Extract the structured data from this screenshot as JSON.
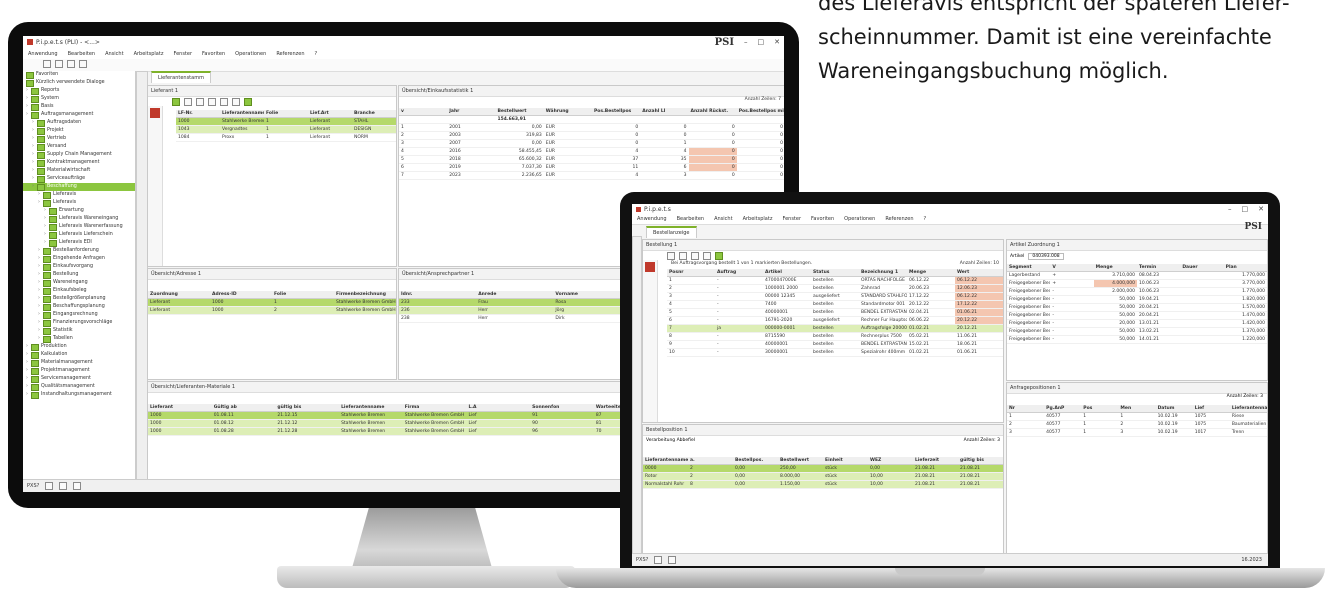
{
  "caption": {
    "line1": "des Lieferavis entspricht der späteren Liefer-",
    "line2": "scheinnummer. Damit ist eine vereinfachte",
    "line3": "Wareneingangsbuchung möglich."
  },
  "desktop": {
    "window_title": "P.i.p.e.t.s (PLI) - <...>",
    "brand": "PSI",
    "menu": [
      "Anwendung",
      "Bearbeiten",
      "Ansicht",
      "Arbeitsplatz",
      "Fenster",
      "Favoriten",
      "Operationen",
      "Referenzen",
      "?"
    ],
    "main_tab": "Lieferantenstamm",
    "nav_items": [
      "Favoriten",
      "Kürzlich verwendete Dialoge",
      "Reports",
      "System",
      "Basis",
      "Auftragsmanagement",
      "Auftragsdaten",
      "Projekt",
      "Vertrieb",
      "Versand",
      "Supply Chain Management",
      "Kontraktmanagement",
      "Materialwirtschaft",
      "Serviceaufträge",
      "Beschaffung",
      "Lieferavis",
      "Lieferavis",
      "Erwartung",
      "Lieferavis Wareneingang",
      "Lieferavis Warenerfassung",
      "Lieferavis Lieferschein",
      "Lieferavis EDI",
      "Bestellanforderung",
      "Eingehende Anfragen",
      "Einkaufsvorgang",
      "Bestellung",
      "Wareneingang",
      "Einkaufsbeleg",
      "Bestellgrößenplanung",
      "Beschaffungsplanung",
      "Eingangsrechnung",
      "Finanzierungsvorschläge",
      "Statistik",
      "Tabellen",
      "Produktion",
      "Kalkulation",
      "Materialmanagement",
      "Projektmanagement",
      "Servicemanagement",
      "Qualitätsmanagement",
      "Instandhaltungsmanagement"
    ],
    "nav_selected": "Beschaffung",
    "status_user": "PXS?",
    "panel_lieferant": {
      "title": "Lieferant 1",
      "columns": [
        "LF-Nr.",
        "Lieferantenname",
        "Folie",
        "Lief.Art",
        "Branche"
      ],
      "rows": [
        [
          "1000",
          "Stahlwerke Bremen",
          "1",
          "Lieferant",
          "STAHL"
        ],
        [
          "1043",
          "Vergnadtes",
          "1",
          "Lieferant",
          "DESIGN"
        ],
        [
          "1084",
          "Proxx",
          "1",
          "Lieferant",
          "NORM"
        ]
      ]
    },
    "panel_umsatz": {
      "title": "Übersicht/Einkaufsstatistik 1",
      "header_note": "Anzahl Zeilen: 7",
      "columns": [
        "v",
        "Jahr",
        "Bestellwert",
        "Währung",
        "Pos.Bestellpos",
        "Anzahl LI",
        "Anzahl Rückst.",
        "Pos.Bestellpos mit Q.M."
      ],
      "total": "154.663,91",
      "rows": [
        [
          "1",
          "2001",
          "0,00",
          "EUR",
          "0",
          "0",
          "0",
          "0"
        ],
        [
          "2",
          "2003",
          "319,83",
          "EUR",
          "0",
          "0",
          "0",
          "0"
        ],
        [
          "3",
          "2007",
          "0,00",
          "EUR",
          "0",
          "1",
          "0",
          "0"
        ],
        [
          "4",
          "2016",
          "58.455,45",
          "EUR",
          "4",
          "4",
          "0",
          "0"
        ],
        [
          "5",
          "2018",
          "65.600,32",
          "EUR",
          "37",
          "35",
          "0",
          "0"
        ],
        [
          "6",
          "2019",
          "7.037,30",
          "EUR",
          "11",
          "6",
          "0",
          "0"
        ],
        [
          "7",
          "2023",
          "2.236,65",
          "EUR",
          "4",
          "3",
          "0",
          "0"
        ]
      ]
    },
    "panel_adressen": {
      "title": "Übersicht/Adresse 1",
      "columns": [
        "Zuordnung",
        "Adress-ID",
        "Folie",
        "Firmenbezeichnung"
      ],
      "rows": [
        [
          "Lieferant",
          "1000",
          "1",
          "Stahlwerke Bremen GmbH"
        ],
        [
          "Lieferant",
          "1000",
          "2",
          "Stahlwerke Bremen GmbH"
        ]
      ]
    },
    "panel_ansprech": {
      "title": "Übersicht/Ansprechpartner 1",
      "columns": [
        "Idnr.",
        "Anrede",
        "Vorname",
        "Nachname",
        "Tel"
      ],
      "rows": [
        [
          "233",
          "Frau",
          "Rosa",
          "Pfaiser",
          "+49 791 7594"
        ],
        [
          "236",
          "Herr",
          "Jörg",
          "Roth",
          "+49 30283"
        ],
        [
          "238",
          "Herr",
          "Dirk",
          "Schultz",
          "+49 30283"
        ]
      ]
    },
    "panel_material": {
      "title": "Übersicht/Lieferanten-Materiale 1",
      "columns": [
        "Lieferant",
        "Gültig ab",
        "gültig bis",
        "Lieferantenname",
        "Firma",
        "L.A",
        "Sonnenfon",
        "Warteeiten",
        "Kursmaßnahmen",
        "Sonstiges"
      ],
      "rows": [
        [
          "1000",
          "01.08.11",
          "21.12.15",
          "Stahlwerke Bremen",
          "Stahlwerke Bremen GmbH",
          "Lief",
          "91",
          "87",
          "150",
          ""
        ],
        [
          "1000",
          "01.08.12",
          "21.12.12",
          "Stahlwerke Bremen",
          "Stahlwerke Bremen GmbH",
          "Lief",
          "90",
          "81",
          "75",
          ""
        ],
        [
          "1000",
          "01.08.28",
          "21.12.28",
          "Stahlwerke Bremen",
          "Stahlwerke Bremen GmbH",
          "Lief",
          "96",
          "70",
          "86",
          ""
        ]
      ]
    }
  },
  "laptop": {
    "window_title": "P.i.p.e.t.s",
    "brand": "PSI",
    "menu": [
      "Anwendung",
      "Bearbeiten",
      "Ansicht",
      "Arbeitsplatz",
      "Fenster",
      "Favoriten",
      "Operationen",
      "Referenzen",
      "?"
    ],
    "main_tab": "Bestellanzeige",
    "panel_bestellung": {
      "title": "Bestellung 1",
      "banner": "Bei Auftragsvorgang bestellt 1 von 1 markierten Bestellungen.",
      "note": "Anzahl Zeilen: 10",
      "columns": [
        "Posnr",
        "Auftrag",
        "Artikel",
        "Status",
        "Bezeichnung 1",
        "Menge",
        "Wert"
      ],
      "rows": [
        [
          "1",
          "-",
          "4700047000E",
          "bestellen",
          "ORTAS NACHFOLGE",
          "06.12.22",
          "06.12.22"
        ],
        [
          "2",
          "-",
          "1000001 2000",
          "bestellen",
          "Zahnrad",
          "20.06.23",
          "12.06.23"
        ],
        [
          "3",
          "-",
          "00000 12345",
          "ausgeliefert",
          "STANDARD STAHLFORM",
          "17.12.22",
          "06.12.22"
        ],
        [
          "4",
          "-",
          "7400",
          "bestellen",
          "Standardmotor 001",
          "20.12.22",
          "17.12.22"
        ],
        [
          "5",
          "-",
          "40000001",
          "bestellen",
          "BENDEL EXTRASTANDARD 9",
          "02.04.21",
          "01.06.21"
        ],
        [
          "6",
          "-",
          "16791-2020",
          "ausgeliefert",
          "Rechner Fur Hauptschaft",
          "06.06.22",
          "20.12.22"
        ],
        [
          "7",
          "ja",
          "000000-0001",
          "bestellen",
          "Auftragsfolge 20000",
          "01.02.21",
          "20.12.21"
        ],
        [
          "8",
          "-",
          "8715590",
          "bestellen",
          "Rechnerplus 7500",
          "05.02.21",
          "11.06.21"
        ],
        [
          "9",
          "-",
          "40000001",
          "bestellen",
          "BENDEL EXTRASTANDARD 10",
          "15.02.21",
          "18.06.21"
        ],
        [
          "10",
          "-",
          "30000001",
          "bestellen",
          "Spezialrohr 400mm",
          "01.02.21",
          "01.06.21"
        ]
      ]
    },
    "panel_artikel": {
      "title": "Artikel Zuordnung 1",
      "artikel_label": "Artikel",
      "artikel_value": "040393.008",
      "columns": [
        "Segment",
        "V",
        "Menge",
        "Termin",
        "Dauer",
        "Plan"
      ],
      "rows": [
        [
          "Lagerbestand",
          "+",
          "3.710,000",
          "08.04.23",
          "",
          "1.770,000"
        ],
        [
          "Freigegebener Bedarf",
          "+",
          "4.000,000",
          "10.06.23",
          "",
          "3.770,000"
        ],
        [
          "Freigegebener Bedarf",
          "-",
          "2.000,000",
          "10.06.23",
          "",
          "1.770,000"
        ],
        [
          "Freigegebener Bedarf",
          "-",
          "50,000",
          "19.04.21",
          "",
          "1.820,000"
        ],
        [
          "Freigegebener Bedarf",
          "-",
          "50,000",
          "20.04.21",
          "",
          "1.570,000"
        ],
        [
          "Freigegebener Bedarf",
          "-",
          "50,000",
          "20.04.21",
          "",
          "1.470,000"
        ],
        [
          "Freigegebener Bedarf",
          "-",
          "20,000",
          "13.01.21",
          "",
          "1.420,000"
        ],
        [
          "Freigegebener Bedarf",
          "-",
          "50,000",
          "13.02.21",
          "",
          "1.370,000"
        ],
        [
          "Freigegebener Bedarf",
          "-",
          "50,000",
          "14.01.21",
          "",
          "1.220,000"
        ]
      ]
    },
    "panel_anfrage": {
      "title": "Anfragepositionen 1",
      "note": "Anzahl Zeilen: 3",
      "columns": [
        "Nr",
        "Pg.AnP",
        "Pos",
        "Men",
        "Datum",
        "Lief",
        "Lieferantenname"
      ],
      "rows": [
        [
          "1",
          "40577",
          "1",
          "1",
          "10.02.19",
          "1075",
          "Riese"
        ],
        [
          "2",
          "40577",
          "1",
          "2",
          "10.02.19",
          "1075",
          "Baumaterialien Bodem"
        ],
        [
          "3",
          "40577",
          "1",
          "3",
          "10.02.19",
          "1017",
          "Trenn"
        ]
      ]
    },
    "panel_lieferavis": {
      "title": "Bestellposition 1",
      "subtitle": "Verarbeitung Abbefiel",
      "note": "Anzahl Zeilen: 3",
      "columns": [
        "Lieferantenname",
        "a.",
        "Bestellpos.",
        "Bestellwert",
        "Einheit",
        "WEZ",
        "Lieferzeit",
        "gültig bis"
      ],
      "rows": [
        [
          "0000",
          "2",
          "0,00",
          "250,00",
          "stück",
          "0,00",
          "21.08.21",
          "21.08.21"
        ],
        [
          "Rotor",
          "2",
          "0,00",
          "8.000,00",
          "stück",
          "10,00",
          "21.08.21",
          "21.08.21"
        ],
        [
          "Normalstahl Rohr",
          "8",
          "0,00",
          "1.150,00",
          "stück",
          "10,00",
          "21.08.21",
          "21.08.21"
        ]
      ]
    },
    "status_user": "PXS?",
    "status_right": "16.2023"
  }
}
